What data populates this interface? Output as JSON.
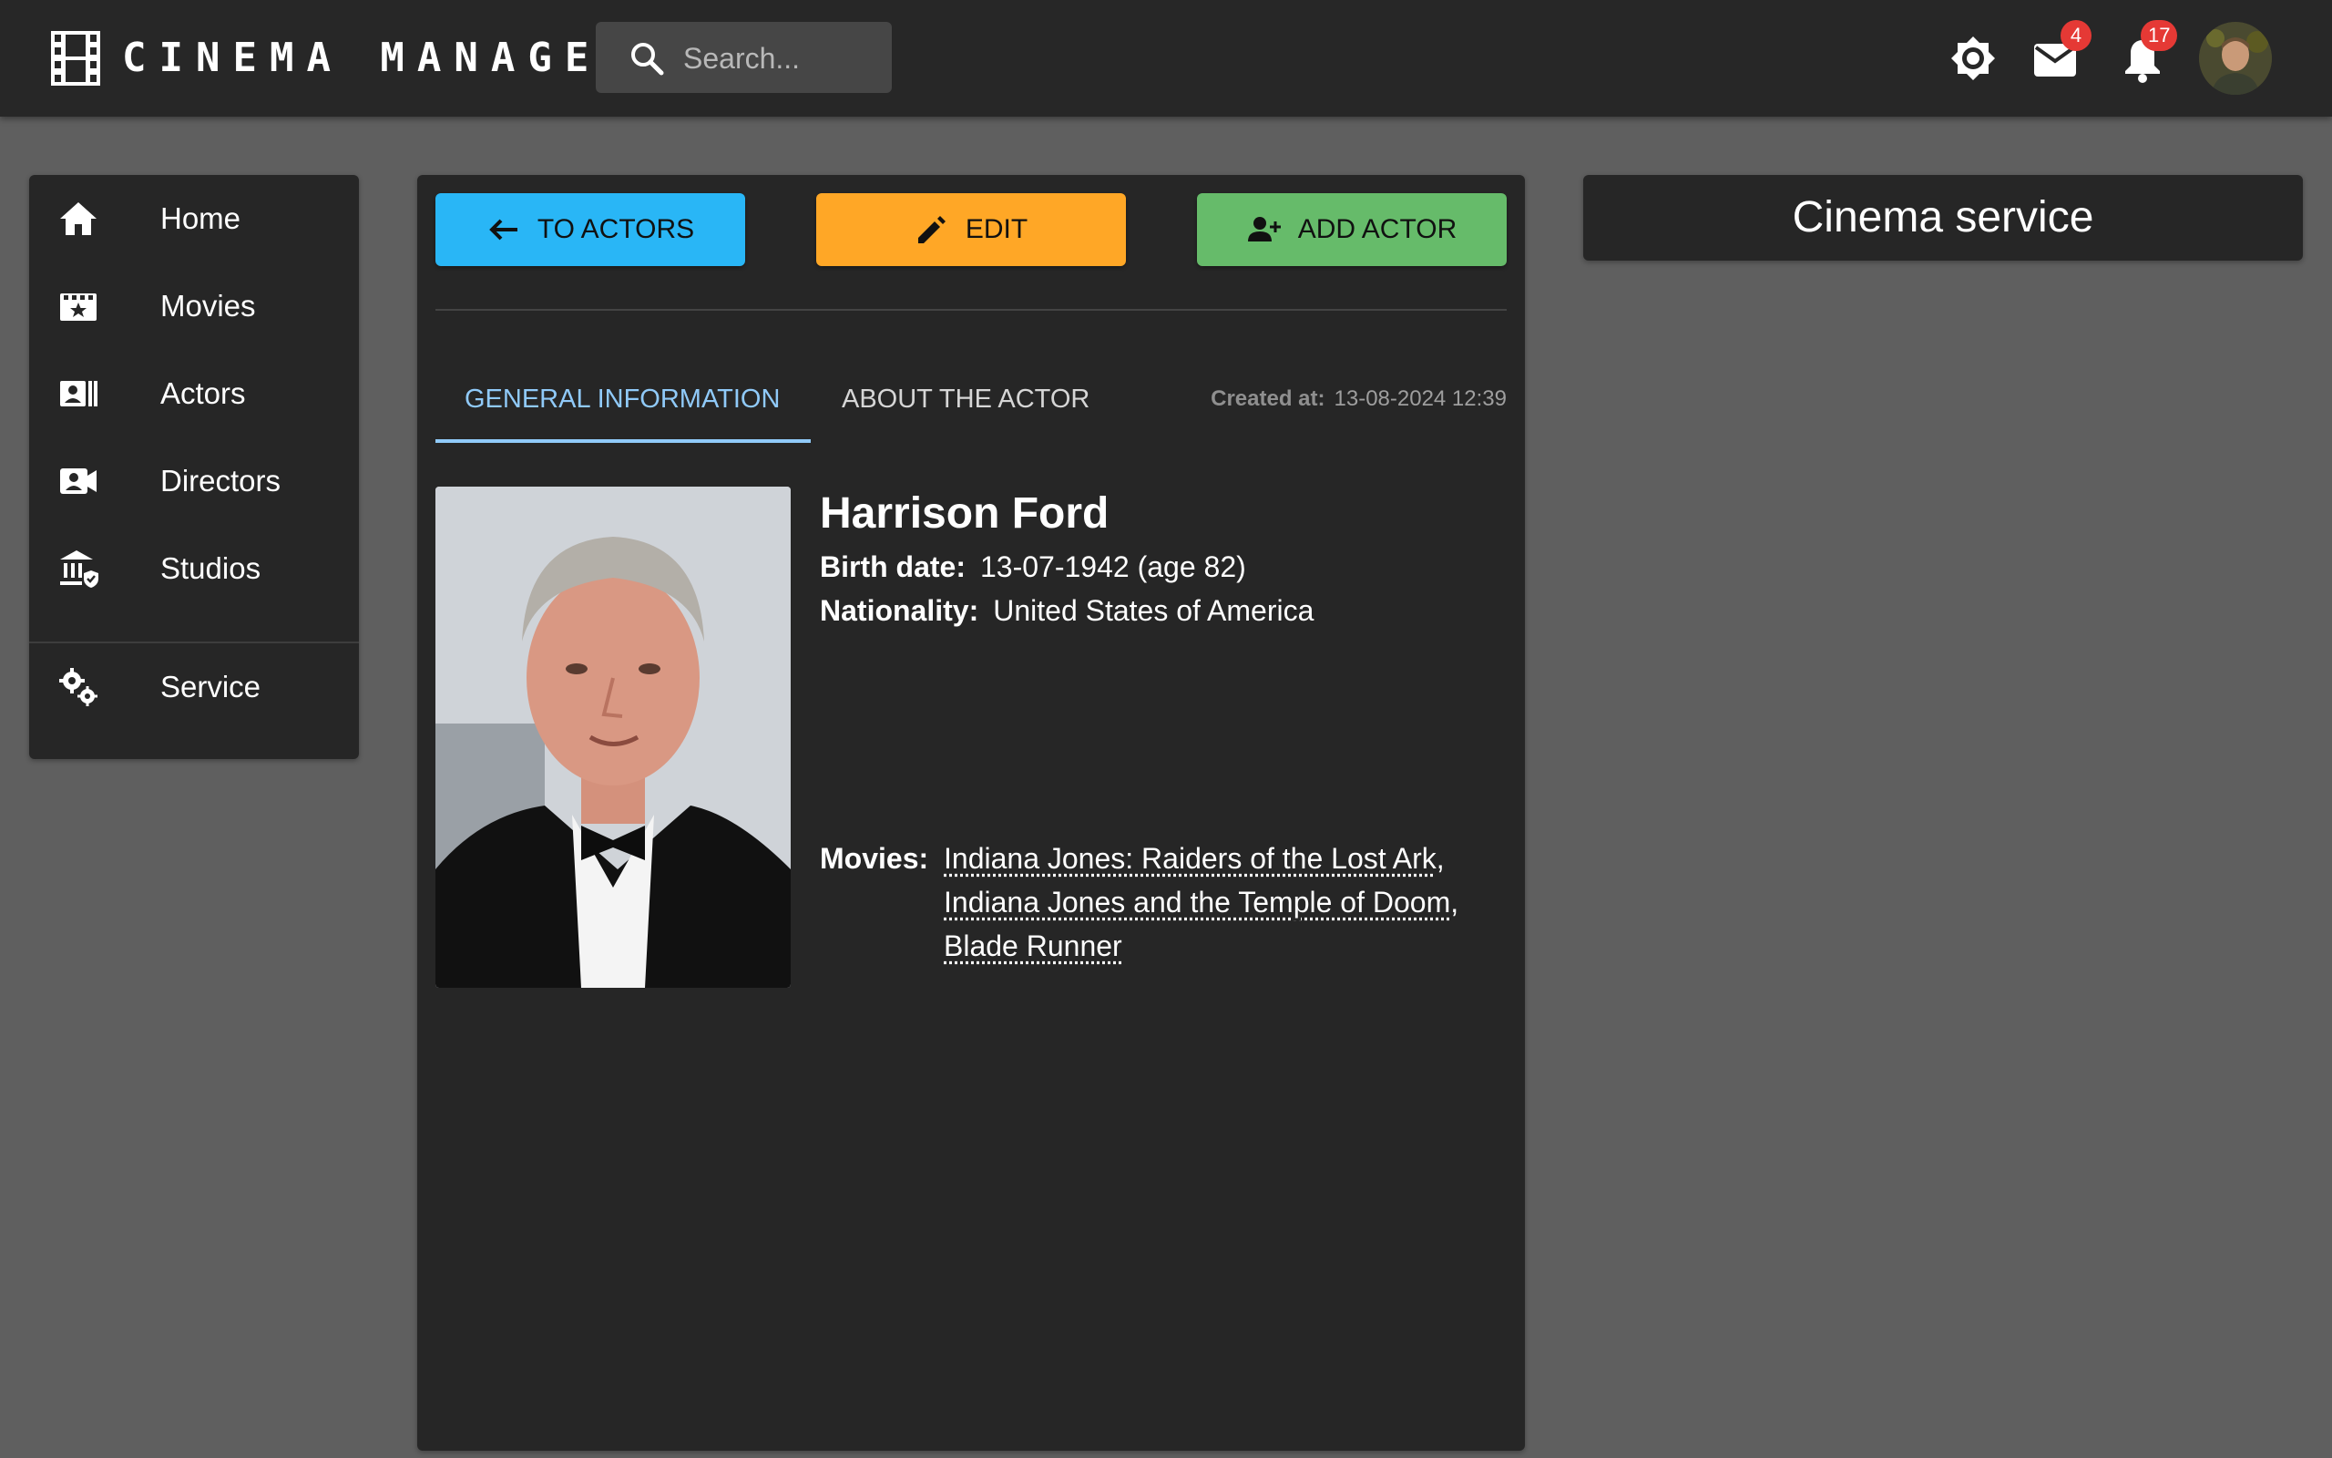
{
  "header": {
    "brand": "CINEMA MANAGER",
    "search_placeholder": "Search...",
    "mail_count": "4",
    "notification_count": "17"
  },
  "sidebar": {
    "items": [
      {
        "label": "Home",
        "icon": "home-icon"
      },
      {
        "label": "Movies",
        "icon": "movies-icon"
      },
      {
        "label": "Actors",
        "icon": "actors-icon"
      },
      {
        "label": "Directors",
        "icon": "directors-icon"
      },
      {
        "label": "Studios",
        "icon": "studios-icon"
      },
      {
        "label": "Service",
        "icon": "service-icon"
      }
    ]
  },
  "toolbar": {
    "back_label": "TO ACTORS",
    "edit_label": "EDIT",
    "add_label": "ADD ACTOR"
  },
  "tabs": {
    "general": "GENERAL INFORMATION",
    "about": "ABOUT THE ACTOR"
  },
  "created": {
    "label": "Created at:",
    "value": "13-08-2024 12:39"
  },
  "actor": {
    "name": "Harrison Ford",
    "birth_label": "Birth date:",
    "birth_value": "13-07-1942 (age 82)",
    "nationality_label": "Nationality:",
    "nationality_value": "United States of America",
    "movies_label": "Movies:",
    "movies": [
      "Indiana Jones: Raiders of the Lost Ark",
      "Indiana Jones and the Temple of Doom",
      "Blade Runner"
    ]
  },
  "panel": {
    "title": "Cinema service"
  },
  "colors": {
    "blue": "#29b6f6",
    "orange": "#ffa726",
    "green": "#66bb6a",
    "accent_tab": "#90caf9",
    "badge": "#e53935"
  }
}
